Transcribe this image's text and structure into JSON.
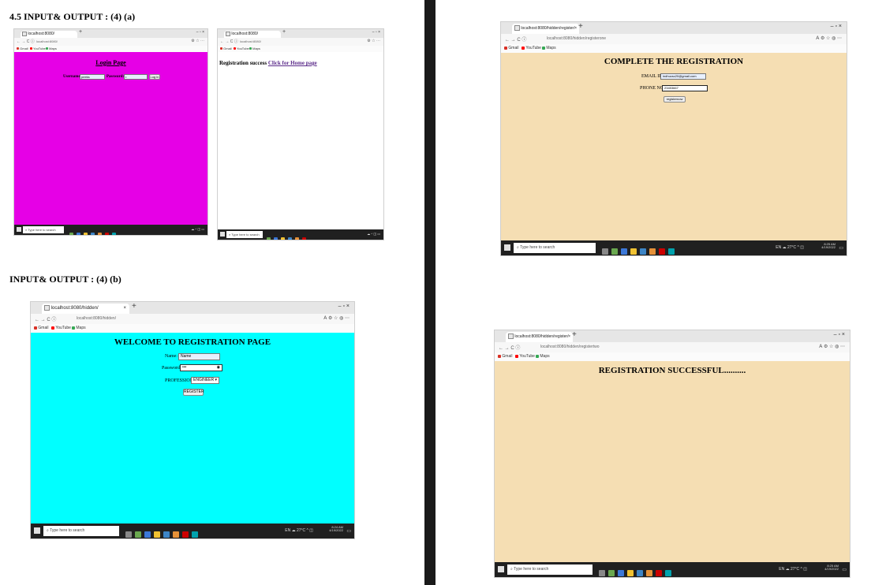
{
  "left_page": {
    "heading_a": "4.5    INPUT& OUTPUT : (4) (a)",
    "heading_b": "INPUT& OUTPUT : (4) (b)"
  },
  "colors": {
    "login_bg": "#e600e6",
    "registration_bg": "#00ffff",
    "complete_bg": "#f5deb3",
    "success_bg": "#f5deb3",
    "link": "#5b2b8a",
    "taskbar": "#202020"
  },
  "common": {
    "search_placeholder": "Type here to search",
    "weather": "27°C",
    "language": "EN",
    "bookmarks": [
      "Gmail",
      "YouTube",
      "Maps"
    ],
    "win_controls": "–   ▫   ×",
    "nav": "←  →  C  ⓘ"
  },
  "shot_login": {
    "tab_label": "localhost:8080/",
    "url": "localhost:8080/",
    "page_title": "Login Page",
    "username_label": "Username:",
    "username_value": "peeks",
    "password_label": "Password:",
    "login_button": "Log in"
  },
  "shot_success_link": {
    "tab_label": "localhost:8080/",
    "url": "localhost:8080/",
    "message": "Registration success",
    "link": "Click for Home page"
  },
  "shot_complete": {
    "tab_label": "localhost:8080/hidden/register/",
    "url": "localhost:8080/hidden/registerone",
    "page_title": "COMPLETE THE REGISTRATION",
    "email_label": "EMAIL ID:",
    "email_value": "indhucsc20@gmail.com",
    "phone_label": "PHONE NO:",
    "phone_value": "23453667",
    "button": "registernow",
    "time": "8:25 AM",
    "date": "4/19/2022"
  },
  "shot_welcome": {
    "tab_label": "localhost:8080/hidden/",
    "url": "localhost:8080/hidden/",
    "page_title": "WELCOME TO REGISTRATION PAGE",
    "name_label": "Name:",
    "name_value": "Name",
    "password_label": "Password:",
    "password_value": "•••",
    "profession_label": "PROFESSION:",
    "profession_value": "ENGINEER",
    "button": "REGISTER",
    "time": "8:24 AM",
    "date": "4/19/2022"
  },
  "shot_final": {
    "tab_label": "localhost:8080/hidden/register/",
    "url": "localhost:8080/hidden/registertwo",
    "page_title": "REGISTRATION SUCCESSFUL..........",
    "time": "8:25 AM",
    "date": "4/19/2022"
  }
}
